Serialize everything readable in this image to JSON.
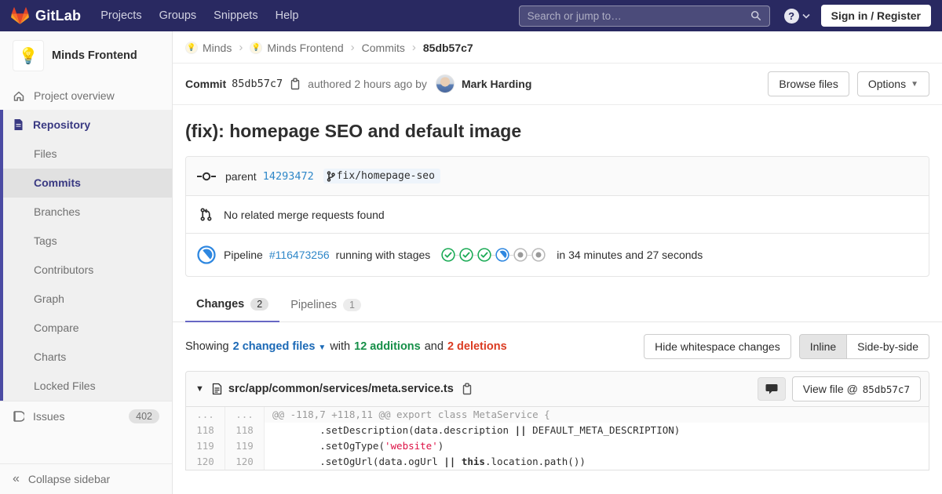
{
  "navbar": {
    "logo_text": "GitLab",
    "links": [
      "Projects",
      "Groups",
      "Snippets",
      "Help"
    ],
    "search_placeholder": "Search or jump to…",
    "sign_in_label": "Sign in / Register"
  },
  "sidebar": {
    "project_name": "Minds Frontend",
    "project_avatar": "💡",
    "overview_label": "Project overview",
    "repository_label": "Repository",
    "repository_items": [
      "Files",
      "Commits",
      "Branches",
      "Tags",
      "Contributors",
      "Graph",
      "Compare",
      "Charts",
      "Locked Files"
    ],
    "active_item": "Commits",
    "issues_label": "Issues",
    "issues_count": "402",
    "collapse_label": "Collapse sidebar"
  },
  "breadcrumb": {
    "items": [
      {
        "label": "Minds",
        "avatar": "💡"
      },
      {
        "label": "Minds Frontend",
        "avatar": "💡"
      },
      {
        "label": "Commits"
      },
      {
        "label": "85db57c7",
        "current": true
      }
    ]
  },
  "commit": {
    "label": "Commit",
    "sha": "85db57c7",
    "authored_text": "authored 2 hours ago by",
    "author_name": "Mark Harding",
    "browse_files_label": "Browse files",
    "options_label": "Options",
    "title": "(fix): homepage SEO and default image",
    "parent_label": "parent",
    "parent_sha": "14293472",
    "branch_name": "fix/homepage-seo",
    "merge_requests_text": "No related merge requests found",
    "pipeline": {
      "label": "Pipeline",
      "id": "#116473256",
      "status_text": "running with stages",
      "stages": [
        "passed",
        "passed",
        "passed",
        "running",
        "pending",
        "pending"
      ],
      "duration_text": "in 34 minutes and 27 seconds"
    }
  },
  "tabs": [
    {
      "label": "Changes",
      "count": "2",
      "active": true
    },
    {
      "label": "Pipelines",
      "count": "1",
      "active": false
    }
  ],
  "diff_summary": {
    "showing_label": "Showing",
    "changed_files_label": "2 changed files",
    "with_label": "with",
    "additions_label": "12 additions",
    "and_label": "and",
    "deletions_label": "2 deletions",
    "hide_whitespace_label": "Hide whitespace changes",
    "inline_label": "Inline",
    "side_by_side_label": "Side-by-side"
  },
  "diff_file": {
    "path": "src/app/common/services/meta.service.ts",
    "view_file_label": "View file @",
    "view_file_sha": "85db57c7",
    "lines": [
      {
        "type": "match",
        "old": "...",
        "new": "...",
        "segments": [
          {
            "t": "@@ -118,7 +118,11 @@ export class MetaService {"
          }
        ]
      },
      {
        "type": "context",
        "old": "118",
        "new": "118",
        "segments": [
          {
            "t": "        .setDescription(data.description "
          },
          {
            "t": "||",
            "b": true
          },
          {
            "t": " DEFAULT_META_DESCRIPTION)"
          }
        ]
      },
      {
        "type": "context",
        "old": "119",
        "new": "119",
        "segments": [
          {
            "t": "        .setOgType("
          },
          {
            "t": "'website'",
            "s": true
          },
          {
            "t": ")"
          }
        ]
      },
      {
        "type": "context",
        "old": "120",
        "new": "120",
        "segments": [
          {
            "t": "        .setOgUrl(data.ogUrl "
          },
          {
            "t": "||",
            "b": true
          },
          {
            "t": " "
          },
          {
            "t": "this",
            "b": true
          },
          {
            "t": ".location.path())"
          }
        ]
      }
    ]
  },
  "colors": {
    "navbar_bg": "#292961",
    "sidebar_active_border": "#4b4ba3",
    "link_blue": "#2e87c8",
    "additions_green": "#168f48",
    "deletions_red": "#db3b21",
    "running_blue": "#2e87e0",
    "passed_green": "#1aaa55",
    "string_red": "#d14"
  }
}
